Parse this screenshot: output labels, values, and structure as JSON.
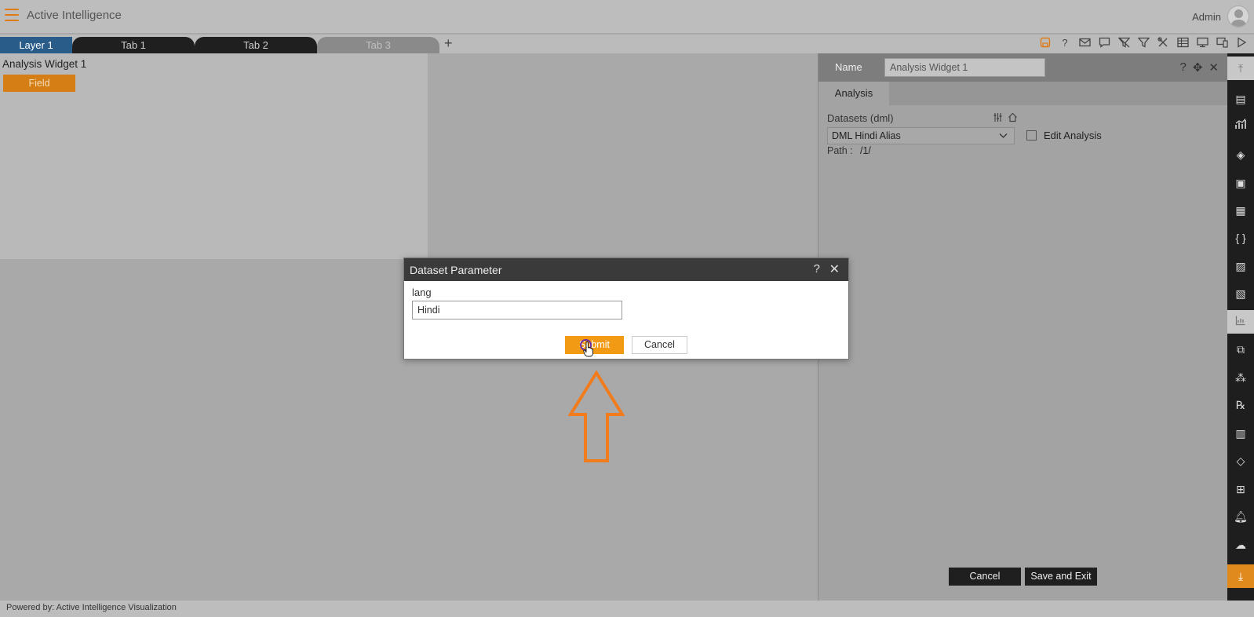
{
  "header": {
    "app_title": "Active Intelligence",
    "user_label": "Admin",
    "menu_icon": "hamburger-menu-icon"
  },
  "tabs": [
    {
      "label": "Layer 1",
      "active": true
    },
    {
      "label": "Tab 1"
    },
    {
      "label": "Tab 2"
    },
    {
      "label": "Tab 3",
      "disabled": true
    }
  ],
  "add_tab_label": "+",
  "toolbar_icons": [
    "save-icon",
    "help-icon",
    "mail-icon",
    "comment-icon",
    "clear-filter-icon",
    "filter-icon",
    "tools-icon",
    "table-icon",
    "monitor-icon",
    "devices-icon",
    "play-icon"
  ],
  "widget": {
    "title": "Analysis Widget 1",
    "field_button": "Field"
  },
  "panel": {
    "name_label": "Name",
    "name_value": "Analysis Widget 1",
    "tab_label": "Analysis",
    "datasets_label": "Datasets (dml)",
    "dataset_selected": "DML Hindi Alias",
    "edit_analysis_label": "Edit Analysis",
    "path_label": "Path :",
    "path_value": "/1/",
    "cancel_label": "Cancel",
    "save_exit_label": "Save and Exit"
  },
  "dialog": {
    "title": "Dataset Parameter",
    "help": "?",
    "close": "✕",
    "param_label": "lang",
    "param_value": "Hindi",
    "submit_label": "Submit",
    "cancel_label": "Cancel"
  },
  "footer": {
    "text": "Powered by: Active Intelligence Visualization"
  },
  "colors": {
    "accent": "#f39a15",
    "layer_tab": "#2a5c8a",
    "dark": "#1f1f1f",
    "arrow": "#f07c1e"
  }
}
